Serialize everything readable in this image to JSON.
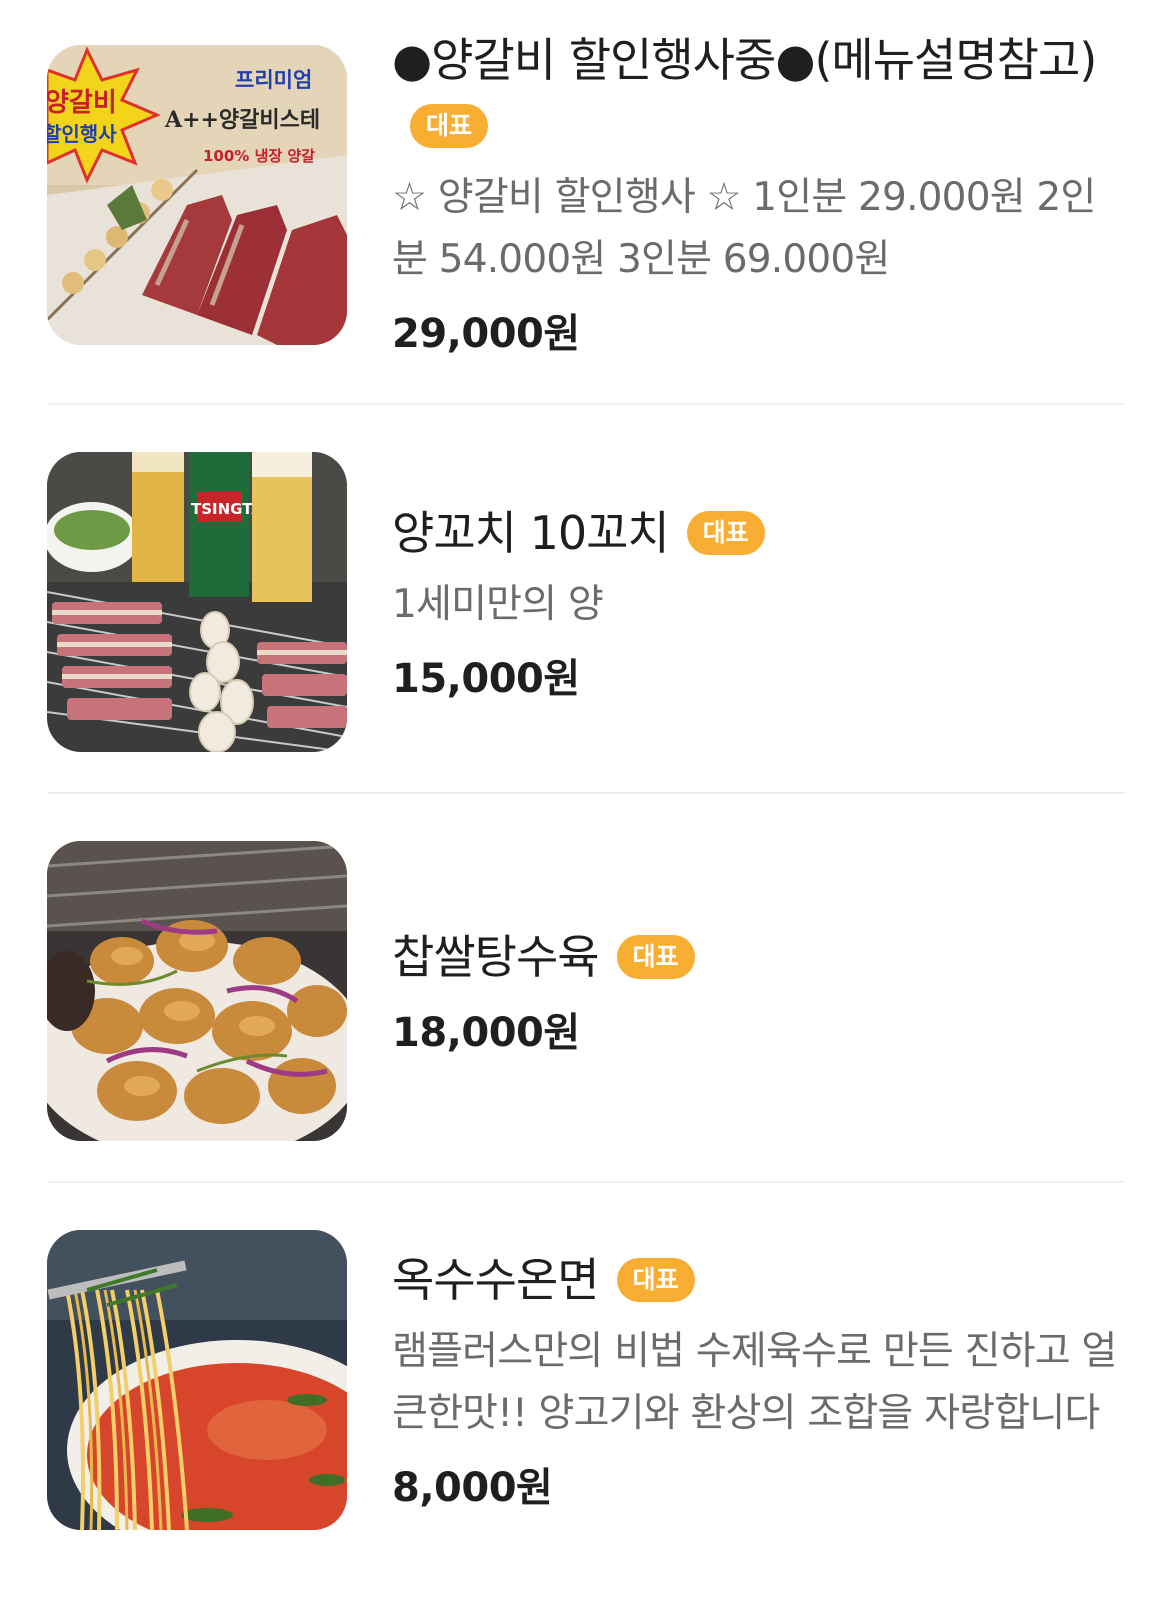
{
  "menu": {
    "items": [
      {
        "name": "●양갈비 할인행사중●(메뉴설명참고)",
        "badge": "대표",
        "description": "☆ 양갈비 할인행사 ☆ 1인분 29.000원 2인분 54.000원 3인분 69.000원",
        "price": "29,000원",
        "image_text": {
          "starburst_line1": "양갈비",
          "starburst_line2": "할인행사",
          "premium": "프리미엄",
          "product": "A++양갈비스테",
          "sub": "100% 냉장 양갈"
        }
      },
      {
        "name": "양꼬치 10꼬치",
        "badge": "대표",
        "description": "1세미만의 양",
        "price": "15,000원",
        "image_text": {
          "beer_brand": "TSINGTAO"
        }
      },
      {
        "name": "찹쌀탕수육",
        "badge": "대표",
        "description": "",
        "price": "18,000원"
      },
      {
        "name": "옥수수온면",
        "badge": "대표",
        "description": "램플러스만의 비법 수제육수로 만든 진하고 얼큰한맛!! 양고기와 환상의 조합을 자랑합니다",
        "price": "8,000원"
      }
    ]
  },
  "colors": {
    "badge": "#f7ae33",
    "title": "#1f1f1f",
    "description": "#6b6b6b",
    "divider": "#efefef"
  }
}
